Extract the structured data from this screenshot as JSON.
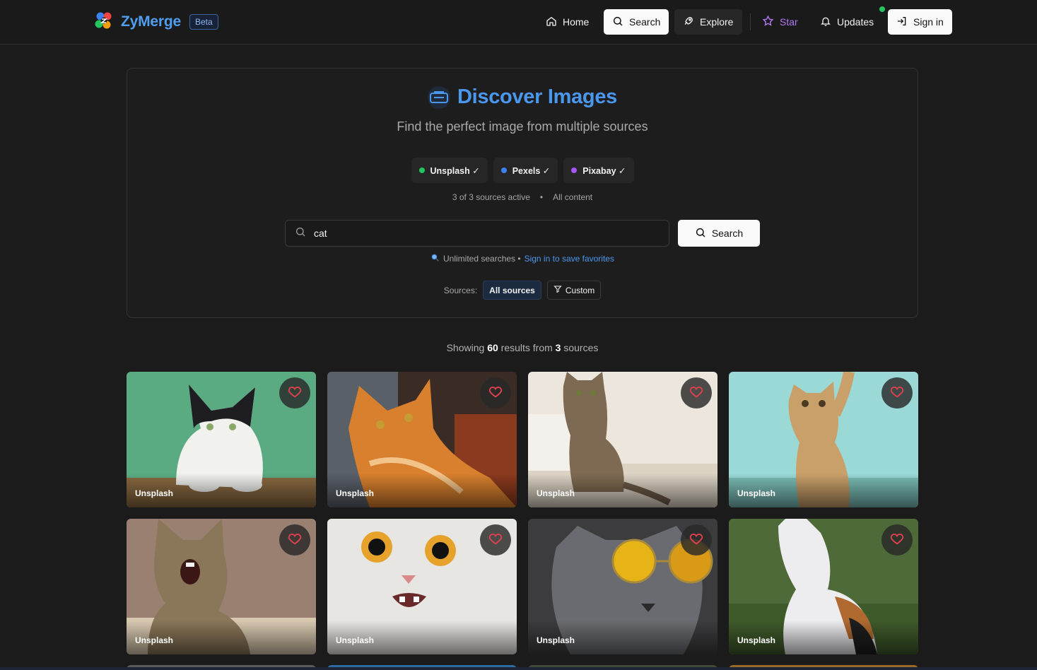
{
  "header": {
    "brand": "ZyMerge",
    "badge": "Beta",
    "nav": [
      {
        "label": "Home",
        "icon": "home-icon"
      },
      {
        "label": "Search",
        "icon": "search-icon"
      },
      {
        "label": "Explore",
        "icon": "rocket-icon"
      },
      {
        "label": "Star",
        "icon": "star-icon"
      },
      {
        "label": "Updates",
        "icon": "bell-icon"
      },
      {
        "label": "Sign in",
        "icon": "sign-in-icon"
      }
    ]
  },
  "hero": {
    "title": "Discover Images",
    "subtitle": "Find the perfect image from multiple sources",
    "sources": [
      {
        "label": "Unsplash ✓",
        "color": "#22c55e"
      },
      {
        "label": "Pexels ✓",
        "color": "#3b82f6"
      },
      {
        "label": "Pixabay ✓",
        "color": "#a855f7"
      }
    ],
    "status_active": "3 of 3 sources active",
    "status_sep": "•",
    "status_content": "All content",
    "search": {
      "value": "cat",
      "button": "Search"
    },
    "hint_text": "Unlimited searches •",
    "hint_link": "Sign in to save favorites",
    "sources_label": "Sources:",
    "filter_all": "All sources",
    "filter_custom": "Custom"
  },
  "results": {
    "prefix": "Showing",
    "count": "60",
    "middle": "results from",
    "source_count": "3",
    "suffix": "sources",
    "cards": [
      {
        "source": "Unsplash"
      },
      {
        "source": "Unsplash"
      },
      {
        "source": "Unsplash"
      },
      {
        "source": "Unsplash"
      },
      {
        "source": "Unsplash"
      },
      {
        "source": "Unsplash"
      },
      {
        "source": "Unsplash"
      },
      {
        "source": "Unsplash"
      }
    ]
  },
  "colors": {
    "accent": "#4a98ee",
    "star": "#b277f0",
    "heart": "#e0414f",
    "online": "#22c55e"
  }
}
